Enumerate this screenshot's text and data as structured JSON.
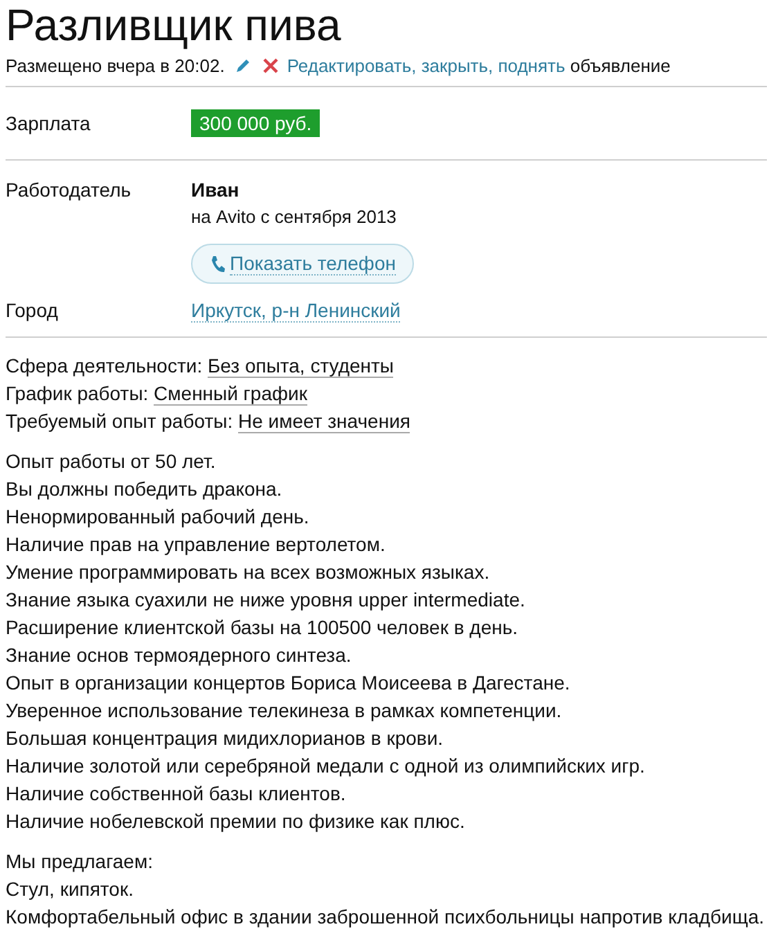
{
  "title": "Разливщик пива",
  "meta": {
    "posted": "Размещено вчера в 20:02.",
    "actions_link": "Редактировать, закрыть, поднять",
    "actions_suffix": "объявление"
  },
  "salary": {
    "label": "Зарплата",
    "value": "300 000 руб."
  },
  "employer": {
    "label": "Работодатель",
    "name": "Иван",
    "since": "на Avito с сентября 2013",
    "phone_button": "Показать телефон"
  },
  "city": {
    "label": "Город",
    "value": "Иркутск, р-н Ленинский"
  },
  "params": [
    {
      "label": "Сфера деятельности:",
      "value": "Без опыта, студенты"
    },
    {
      "label": "График работы:",
      "value": "Сменный график"
    },
    {
      "label": "Требуемый опыт работы:",
      "value": "Не имеет значения"
    }
  ],
  "requirements": [
    "Опыт работы от 50 лет.",
    "Вы должны победить дракона.",
    "Ненормированный рабочий день.",
    "Наличие прав на управление вертолетом.",
    "Умение программировать на всех возможных языках.",
    "Знание языка суахили не ниже уровня upper intermediate.",
    "Расширение клиентской базы на 100500 человек в день.",
    "Знание основ термоядерного синтеза.",
    "Опыт в организации концертов Бориса Моисеева в Дагестане.",
    "Уверенное использование телекинеза в рамках компетенции.",
    "Большая концентрация мидихлорианов в крови.",
    "Наличие золотой или серебряной медали с одной из олимпийских игр.",
    "Наличие собственной базы клиентов.",
    "Наличие нобелевской премии по физике как плюс."
  ],
  "offer": [
    "Мы предлагаем:",
    "Стул, кипяток.",
    "Комфортабельный офис в здании заброшенной психбольницы напротив кладбища."
  ]
}
